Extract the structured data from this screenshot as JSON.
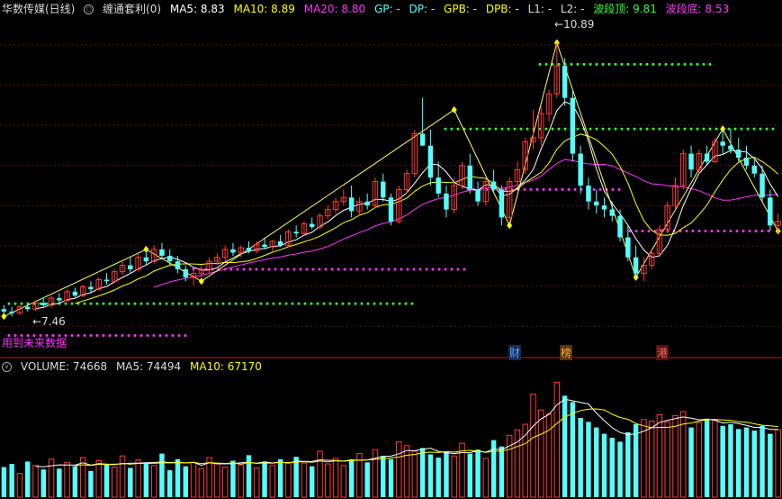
{
  "main_header": {
    "stock_name": "华数传媒(日线)",
    "indicator": "缠通套利(0)",
    "ma5": "MA5: 8.83",
    "ma10": "MA10: 8.89",
    "ma20": "MA20: 8.80",
    "gp": "GP: -",
    "dp": "DP: -",
    "gpb": "GPB: -",
    "dpb": "DPB: -",
    "l1": "L1: -",
    "l2": "L2: -",
    "wave_top": "波段顶: 9.81",
    "wave_bottom": "波段底: 8.53"
  },
  "vol_header": {
    "volume": "VOLUME: 74668",
    "ma5": "MA5: 74494",
    "ma10": "MA10: 67170"
  },
  "labels": {
    "high_price": "10.89",
    "low_price": "7.46",
    "tail_text": "用到未来数据"
  },
  "tags": {
    "cai": "财",
    "bang": "榜",
    "gang": "港"
  },
  "colors": {
    "up": "#ff3b3b",
    "down": "#54ffff",
    "ma5": "#ffffff",
    "ma10": "#ffff00",
    "ma20": "#ff33ff",
    "wave_top": "#33ff33",
    "wave_bottom": "#ff33ff",
    "zigzag": "#ffff66",
    "pivot": "#ffff00"
  },
  "chart_data": {
    "type": "candlestick",
    "price_range": [
      7.0,
      11.2
    ],
    "candles": [
      [
        7.55,
        7.6,
        7.48,
        7.52
      ],
      [
        7.52,
        7.58,
        7.46,
        7.5
      ],
      [
        7.5,
        7.6,
        7.48,
        7.58
      ],
      [
        7.58,
        7.62,
        7.52,
        7.55
      ],
      [
        7.55,
        7.66,
        7.53,
        7.63
      ],
      [
        7.63,
        7.7,
        7.58,
        7.6
      ],
      [
        7.6,
        7.72,
        7.57,
        7.69
      ],
      [
        7.69,
        7.75,
        7.62,
        7.66
      ],
      [
        7.66,
        7.8,
        7.64,
        7.77
      ],
      [
        7.77,
        7.82,
        7.7,
        7.72
      ],
      [
        7.72,
        7.86,
        7.7,
        7.83
      ],
      [
        7.83,
        7.9,
        7.76,
        7.8
      ],
      [
        7.8,
        7.95,
        7.78,
        7.92
      ],
      [
        7.92,
        8.0,
        7.86,
        7.9
      ],
      [
        7.9,
        8.05,
        7.88,
        8.02
      ],
      [
        8.02,
        8.15,
        7.98,
        8.1
      ],
      [
        8.1,
        8.2,
        8.0,
        8.05
      ],
      [
        8.05,
        8.25,
        8.02,
        8.2
      ],
      [
        8.2,
        8.3,
        8.1,
        8.15
      ],
      [
        8.15,
        8.35,
        8.12,
        8.3
      ],
      [
        8.3,
        8.38,
        8.18,
        8.22
      ],
      [
        8.22,
        8.3,
        8.1,
        8.15
      ],
      [
        8.15,
        8.22,
        8.0,
        8.05
      ],
      [
        8.05,
        8.1,
        7.9,
        7.95
      ],
      [
        7.95,
        8.05,
        7.85,
        8.0
      ],
      [
        8.0,
        8.1,
        7.95,
        8.05
      ],
      [
        8.05,
        8.2,
        8.0,
        8.15
      ],
      [
        8.15,
        8.25,
        8.1,
        8.2
      ],
      [
        8.2,
        8.35,
        8.15,
        8.3
      ],
      [
        8.3,
        8.38,
        8.22,
        8.26
      ],
      [
        8.26,
        8.35,
        8.2,
        8.32
      ],
      [
        8.32,
        8.4,
        8.25,
        8.28
      ],
      [
        8.28,
        8.4,
        8.25,
        8.36
      ],
      [
        8.36,
        8.45,
        8.3,
        8.33
      ],
      [
        8.33,
        8.42,
        8.28,
        8.4
      ],
      [
        8.4,
        8.48,
        8.33,
        8.35
      ],
      [
        8.35,
        8.55,
        8.33,
        8.52
      ],
      [
        8.52,
        8.6,
        8.45,
        8.5
      ],
      [
        8.5,
        8.65,
        8.48,
        8.62
      ],
      [
        8.62,
        8.7,
        8.55,
        8.58
      ],
      [
        8.58,
        8.75,
        8.55,
        8.72
      ],
      [
        8.72,
        8.85,
        8.68,
        8.8
      ],
      [
        8.8,
        8.95,
        8.75,
        8.9
      ],
      [
        8.9,
        9.05,
        8.85,
        8.95
      ],
      [
        8.95,
        9.1,
        8.7,
        8.78
      ],
      [
        8.78,
        8.95,
        8.72,
        8.9
      ],
      [
        8.9,
        9.0,
        8.8,
        8.85
      ],
      [
        8.85,
        9.2,
        8.82,
        9.15
      ],
      [
        9.15,
        9.25,
        8.9,
        8.95
      ],
      [
        8.95,
        9.0,
        8.6,
        8.65
      ],
      [
        8.65,
        9.1,
        8.62,
        9.05
      ],
      [
        9.05,
        9.3,
        9.0,
        9.25
      ],
      [
        9.25,
        9.8,
        9.2,
        9.75
      ],
      [
        9.75,
        10.2,
        9.6,
        9.6
      ],
      [
        9.6,
        9.8,
        9.1,
        9.2
      ],
      [
        9.2,
        9.4,
        8.95,
        9.0
      ],
      [
        9.0,
        9.1,
        8.7,
        8.8
      ],
      [
        8.8,
        9.2,
        8.75,
        9.1
      ],
      [
        9.1,
        9.4,
        9.05,
        9.35
      ],
      [
        9.35,
        9.5,
        9.0,
        9.05
      ],
      [
        9.05,
        9.15,
        8.85,
        8.9
      ],
      [
        8.9,
        9.2,
        8.85,
        9.15
      ],
      [
        9.15,
        9.3,
        9.0,
        9.05
      ],
      [
        9.05,
        9.1,
        8.6,
        8.7
      ],
      [
        8.7,
        9.2,
        8.65,
        9.15
      ],
      [
        9.15,
        9.4,
        9.1,
        9.3
      ],
      [
        9.3,
        9.7,
        9.25,
        9.65
      ],
      [
        9.65,
        10.05,
        9.55,
        9.7
      ],
      [
        9.7,
        10.1,
        9.6,
        10.0
      ],
      [
        10.0,
        10.3,
        9.9,
        10.25
      ],
      [
        10.25,
        10.89,
        10.2,
        10.6
      ],
      [
        10.6,
        10.7,
        10.1,
        10.2
      ],
      [
        10.2,
        10.3,
        9.4,
        9.5
      ],
      [
        9.5,
        9.6,
        9.0,
        9.1
      ],
      [
        9.1,
        9.2,
        8.8,
        8.9
      ],
      [
        8.9,
        9.05,
        8.75,
        8.85
      ],
      [
        8.85,
        8.95,
        8.7,
        8.8
      ],
      [
        8.8,
        8.9,
        8.65,
        8.72
      ],
      [
        8.72,
        8.8,
        8.4,
        8.45
      ],
      [
        8.45,
        8.6,
        8.15,
        8.2
      ],
      [
        8.2,
        8.35,
        7.95,
        8.0
      ],
      [
        8.0,
        8.2,
        7.9,
        8.1
      ],
      [
        8.1,
        8.3,
        8.05,
        8.25
      ],
      [
        8.25,
        8.6,
        8.2,
        8.55
      ],
      [
        8.55,
        8.9,
        8.5,
        8.85
      ],
      [
        8.85,
        9.2,
        8.8,
        9.1
      ],
      [
        9.1,
        9.55,
        9.05,
        9.5
      ],
      [
        9.5,
        9.6,
        9.2,
        9.3
      ],
      [
        9.3,
        9.55,
        9.25,
        9.5
      ],
      [
        9.5,
        9.6,
        9.35,
        9.4
      ],
      [
        9.4,
        9.7,
        9.38,
        9.65
      ],
      [
        9.65,
        9.8,
        9.5,
        9.6
      ],
      [
        9.6,
        9.81,
        9.5,
        9.55
      ],
      [
        9.55,
        9.7,
        9.4,
        9.45
      ],
      [
        9.45,
        9.6,
        9.3,
        9.35
      ],
      [
        9.35,
        9.45,
        9.2,
        9.25
      ],
      [
        9.25,
        9.35,
        8.9,
        8.95
      ],
      [
        8.95,
        9.05,
        8.53,
        8.6
      ],
      [
        8.6,
        8.75,
        8.5,
        8.65
      ]
    ],
    "volumes": [
      38,
      42,
      30,
      45,
      40,
      35,
      48,
      36,
      44,
      39,
      50,
      33,
      46,
      41,
      38,
      52,
      37,
      47,
      43,
      40,
      55,
      34,
      48,
      39,
      44,
      36,
      50,
      42,
      38,
      46,
      41,
      53,
      37,
      45,
      40,
      48,
      44,
      51,
      43,
      39,
      58,
      42,
      49,
      40,
      47,
      55,
      44,
      60,
      52,
      48,
      70,
      65,
      58,
      62,
      54,
      50,
      57,
      52,
      68,
      55,
      60,
      49,
      72,
      64,
      78,
      85,
      92,
      130,
      110,
      105,
      145,
      128,
      120,
      100,
      95,
      88,
      80,
      75,
      70,
      82,
      92,
      98,
      96,
      104,
      95,
      103,
      108,
      88,
      94,
      99,
      97,
      90,
      92,
      86,
      88,
      84,
      90,
      80,
      85
    ],
    "wave_top_price": 9.81,
    "wave_bottom_price": 8.53
  }
}
